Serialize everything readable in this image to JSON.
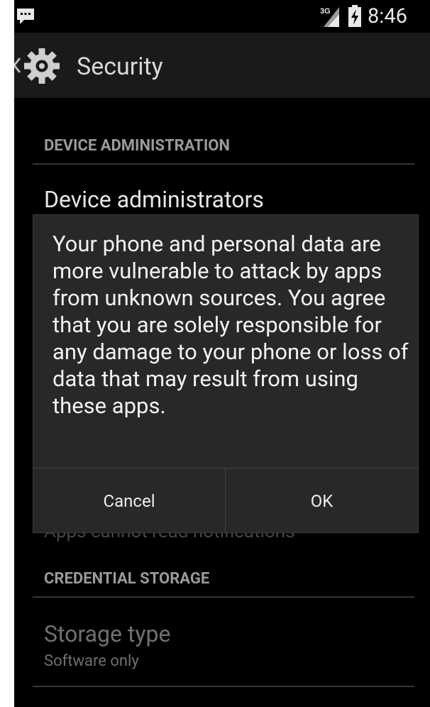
{
  "status_bar": {
    "network_label": "3G",
    "time": "8:46",
    "icons": [
      "message-icon",
      "signal-icon",
      "battery-icon"
    ]
  },
  "action_bar": {
    "title": "Security",
    "icons": [
      "up-chevron-icon",
      "gear-icon"
    ]
  },
  "list": {
    "section1_header": "DEVICE ADMINISTRATION",
    "device_admins_title": "Device administrators",
    "notification_access_summary": "Apps cannot read notifications",
    "section2_header": "CREDENTIAL STORAGE",
    "storage_type_title": "Storage type",
    "storage_type_summary": "Software only"
  },
  "dialog": {
    "message": "Your phone and personal data are more vulnerable to attack by apps from unknown sources. You agree that you are solely responsible for any damage to your phone or loss of data that may result from using these apps.",
    "cancel_label": "Cancel",
    "ok_label": "OK"
  },
  "colors": {
    "background": "#000000",
    "action_bar": "#1a1a1a",
    "dialog": "#282828",
    "section_header": "#9a9a9a",
    "text_primary": "#e6e6e6",
    "text_secondary": "#6f6f6f"
  }
}
